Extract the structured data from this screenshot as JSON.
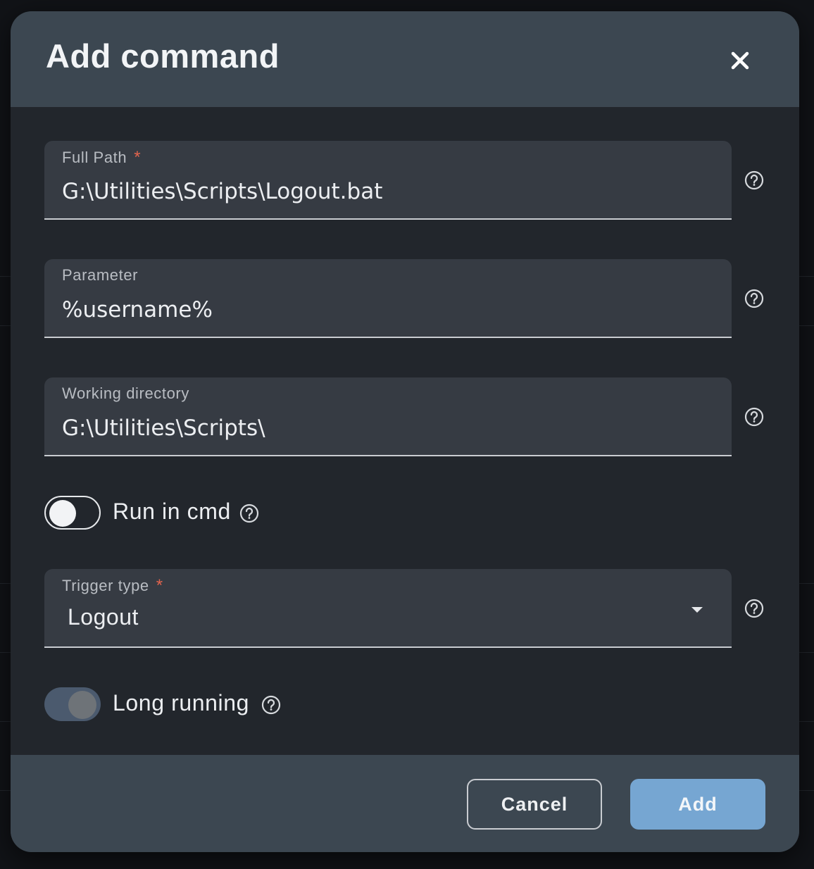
{
  "dialog": {
    "title": "Add command",
    "fields": {
      "full_path": {
        "label": "Full Path",
        "required_mark": "*",
        "value": "G:\\Utilities\\Scripts\\Logout.bat"
      },
      "parameter": {
        "label": "Parameter",
        "value": "%username%"
      },
      "working_directory": {
        "label": "Working directory",
        "value": "G:\\Utilities\\Scripts\\"
      },
      "trigger_type": {
        "label": "Trigger type",
        "required_mark": "*",
        "selected": "Logout"
      }
    },
    "toggles": {
      "run_in_cmd": {
        "label": "Run in cmd",
        "checked": false
      },
      "long_running": {
        "label": "Long running",
        "checked": true,
        "disabled": true
      }
    },
    "buttons": {
      "cancel": "Cancel",
      "add": "Add"
    }
  },
  "colors": {
    "header_bg": "#3c4751",
    "body_bg": "#22262c",
    "field_bg": "#363b43",
    "required": "#e2644e",
    "primary": "#76a6d2"
  },
  "icons": {
    "close": "close-icon",
    "help": "help-circle-icon",
    "dropdown": "caret-down-icon"
  }
}
